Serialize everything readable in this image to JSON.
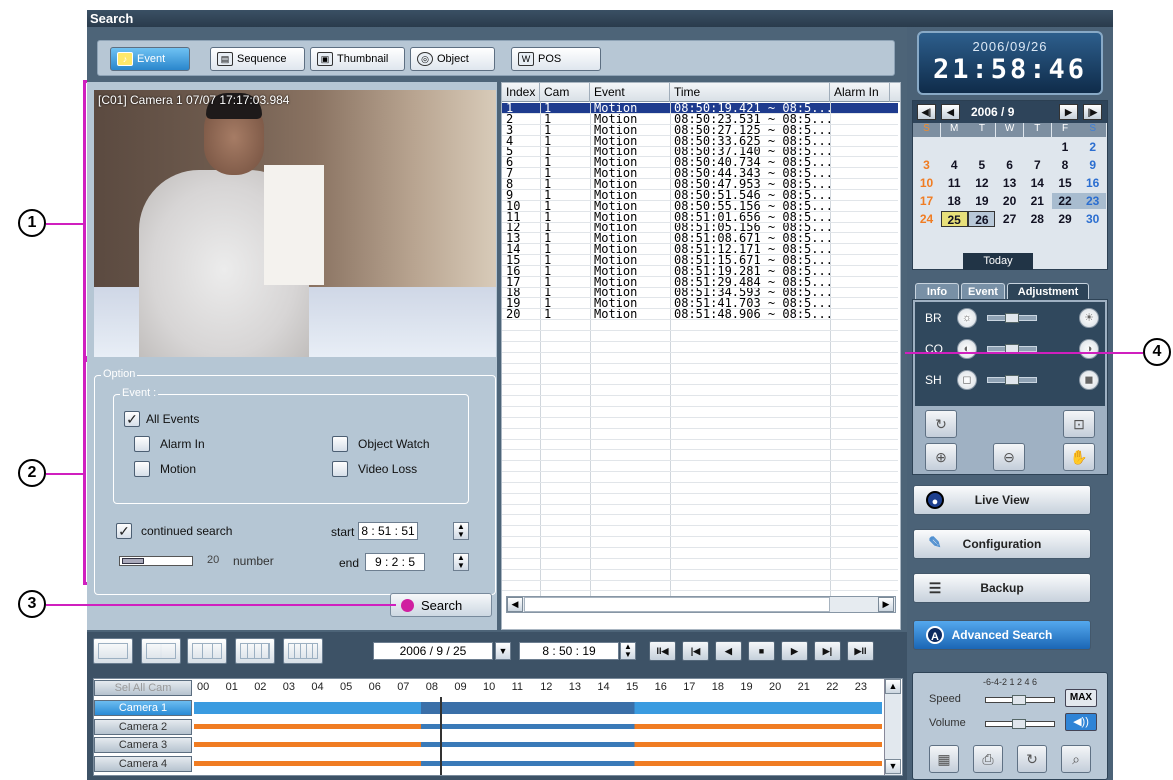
{
  "window": {
    "title": "Search"
  },
  "modes": [
    {
      "label": "Event",
      "icon": "bell-icon",
      "active": true
    },
    {
      "label": "Sequence",
      "icon": "sequence-icon",
      "active": false
    },
    {
      "label": "Thumbnail",
      "icon": "thumbnail-icon",
      "active": false
    },
    {
      "label": "Object",
      "icon": "object-icon",
      "active": false
    },
    {
      "label": "POS",
      "icon": "pos-icon",
      "active": false
    }
  ],
  "video": {
    "caption": "[C01] Camera 1 07/07 17:17:03.984"
  },
  "option": {
    "title": "Option",
    "event_group": "Event :",
    "all_events": "All Events",
    "alarm_in": "Alarm In",
    "object_watch": "Object Watch",
    "motion": "Motion",
    "video_loss": "Video Loss",
    "continued_search": "continued search",
    "start_label": "start",
    "start_time": "8 : 51 : 51",
    "end_label": "end",
    "end_time": "9 : 2 : 5",
    "number_value": "20",
    "number_label": "number"
  },
  "search_button": "Search",
  "event_table": {
    "columns": [
      "Index",
      "Cam",
      "Event",
      "Time",
      "Alarm In"
    ],
    "rows": [
      [
        "1",
        "1",
        "Motion",
        "08:50:19.421 ~ 08:5..."
      ],
      [
        "2",
        "1",
        "Motion",
        "08:50:23.531 ~ 08:5..."
      ],
      [
        "3",
        "1",
        "Motion",
        "08:50:27.125 ~ 08:5..."
      ],
      [
        "4",
        "1",
        "Motion",
        "08:50:33.625 ~ 08:5..."
      ],
      [
        "5",
        "1",
        "Motion",
        "08:50:37.140 ~ 08:5..."
      ],
      [
        "6",
        "1",
        "Motion",
        "08:50:40.734 ~ 08:5..."
      ],
      [
        "7",
        "1",
        "Motion",
        "08:50:44.343 ~ 08:5..."
      ],
      [
        "8",
        "1",
        "Motion",
        "08:50:47.953 ~ 08:5..."
      ],
      [
        "9",
        "1",
        "Motion",
        "08:50:51.546 ~ 08:5..."
      ],
      [
        "10",
        "1",
        "Motion",
        "08:50:55.156 ~ 08:5..."
      ],
      [
        "11",
        "1",
        "Motion",
        "08:51:01.656 ~ 08:5..."
      ],
      [
        "12",
        "1",
        "Motion",
        "08:51:05.156 ~ 08:5..."
      ],
      [
        "13",
        "1",
        "Motion",
        "08:51:08.671 ~ 08:5..."
      ],
      [
        "14",
        "1",
        "Motion",
        "08:51:12.171 ~ 08:5..."
      ],
      [
        "15",
        "1",
        "Motion",
        "08:51:15.671 ~ 08:5..."
      ],
      [
        "16",
        "1",
        "Motion",
        "08:51:19.281 ~ 08:5..."
      ],
      [
        "17",
        "1",
        "Motion",
        "08:51:29.484 ~ 08:5..."
      ],
      [
        "18",
        "1",
        "Motion",
        "08:51:34.593 ~ 08:5..."
      ],
      [
        "19",
        "1",
        "Motion",
        "08:51:41.703 ~ 08:5..."
      ],
      [
        "20",
        "1",
        "Motion",
        "08:51:48.906 ~ 08:5..."
      ]
    ]
  },
  "clock": {
    "date": "2006/09/26",
    "time": "21:58:46"
  },
  "calendar": {
    "header": "2006 / 9",
    "weekdays": [
      "S",
      "M",
      "T",
      "W",
      "T",
      "F",
      "S"
    ],
    "weeks": [
      [
        "",
        "",
        "",
        "",
        "",
        "1",
        "2"
      ],
      [
        "3",
        "4",
        "5",
        "6",
        "7",
        "8",
        "9"
      ],
      [
        "10",
        "11",
        "12",
        "13",
        "14",
        "15",
        "16"
      ],
      [
        "17",
        "18",
        "19",
        "20",
        "21",
        "22",
        "23"
      ],
      [
        "24",
        "25",
        "26",
        "27",
        "28",
        "29",
        "30"
      ]
    ],
    "today_button": "Today"
  },
  "side_tabs": [
    "Info",
    "Event",
    "Adjustment"
  ],
  "adjust": {
    "br": "BR",
    "co": "CO",
    "sh": "SH"
  },
  "nav_buttons": {
    "live_view": "Live View",
    "configuration": "Configuration",
    "backup": "Backup",
    "advanced_search": "Advanced Search"
  },
  "playback_settings": {
    "scale": "-6-4-2 1 2 4 6",
    "speed_label": "Speed",
    "max_label": "MAX",
    "volume_label": "Volume"
  },
  "timeline": {
    "date": "2006  /  9  /  25",
    "time": "8  :  50  :  19",
    "select_all": "Sel All Cam",
    "hours": [
      "00",
      "01",
      "02",
      "03",
      "04",
      "05",
      "06",
      "07",
      "08",
      "09",
      "10",
      "11",
      "12",
      "13",
      "14",
      "15",
      "16",
      "17",
      "18",
      "19",
      "20",
      "21",
      "22",
      "23"
    ],
    "cameras": [
      "Camera 1",
      "Camera 2",
      "Camera 3",
      "Camera 4"
    ]
  },
  "callouts": [
    "1",
    "2",
    "3",
    "4"
  ],
  "colors": {
    "callout": "#d01fbf",
    "recording_orange": "#f07c22",
    "recording_blue": "#3a7ab8"
  }
}
